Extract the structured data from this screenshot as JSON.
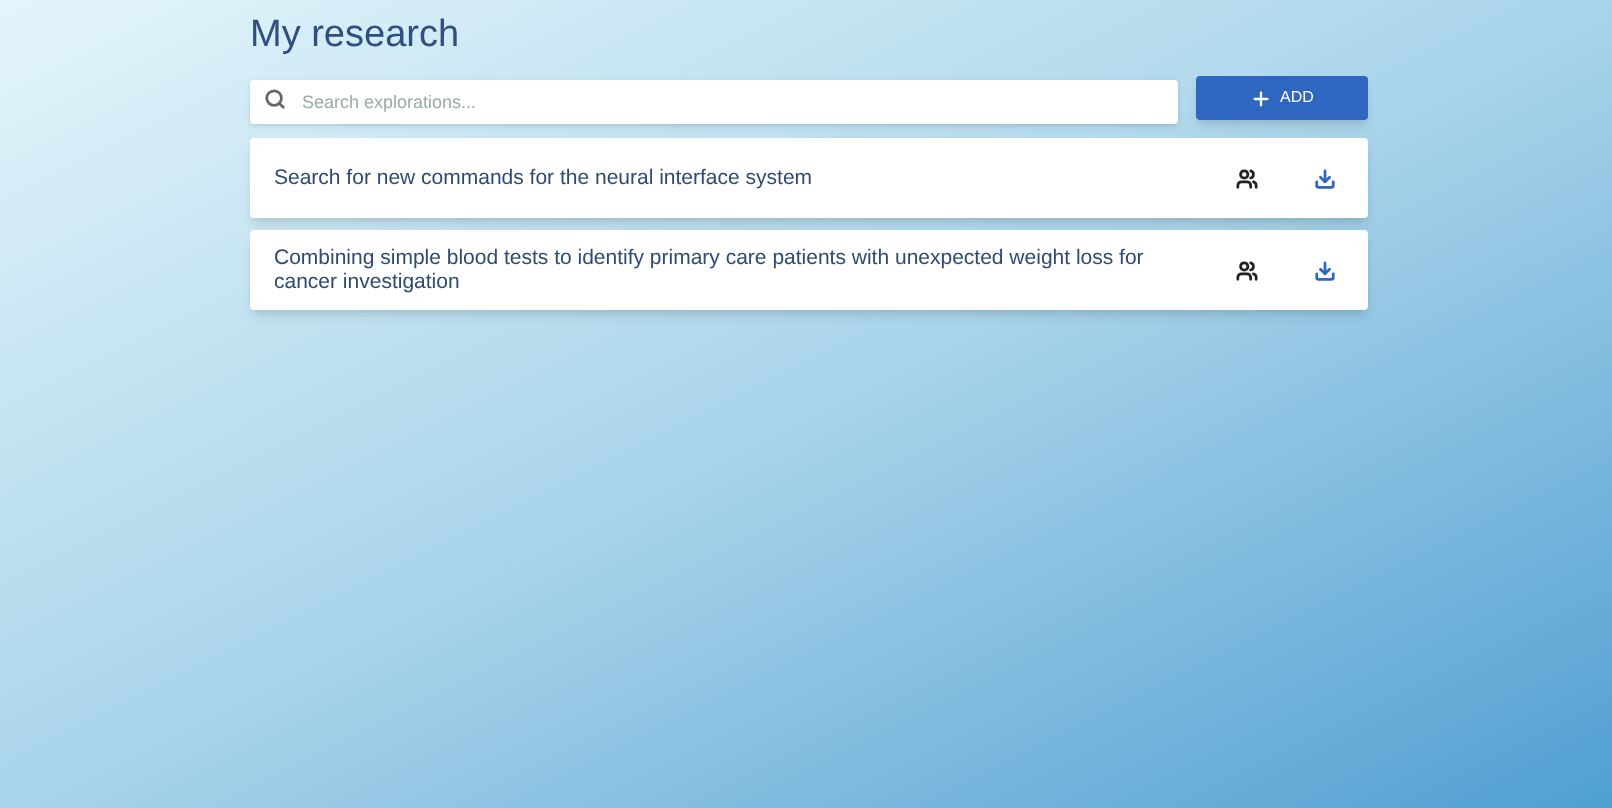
{
  "title": "My research",
  "search": {
    "placeholder": "Search explorations..."
  },
  "add_button": {
    "label": "ADD"
  },
  "explorations": [
    {
      "title": "Search for new commands for the neural interface system"
    },
    {
      "title": "Combining simple blood tests to identify primary care patients with unexpected weight loss for cancer investigation"
    }
  ]
}
